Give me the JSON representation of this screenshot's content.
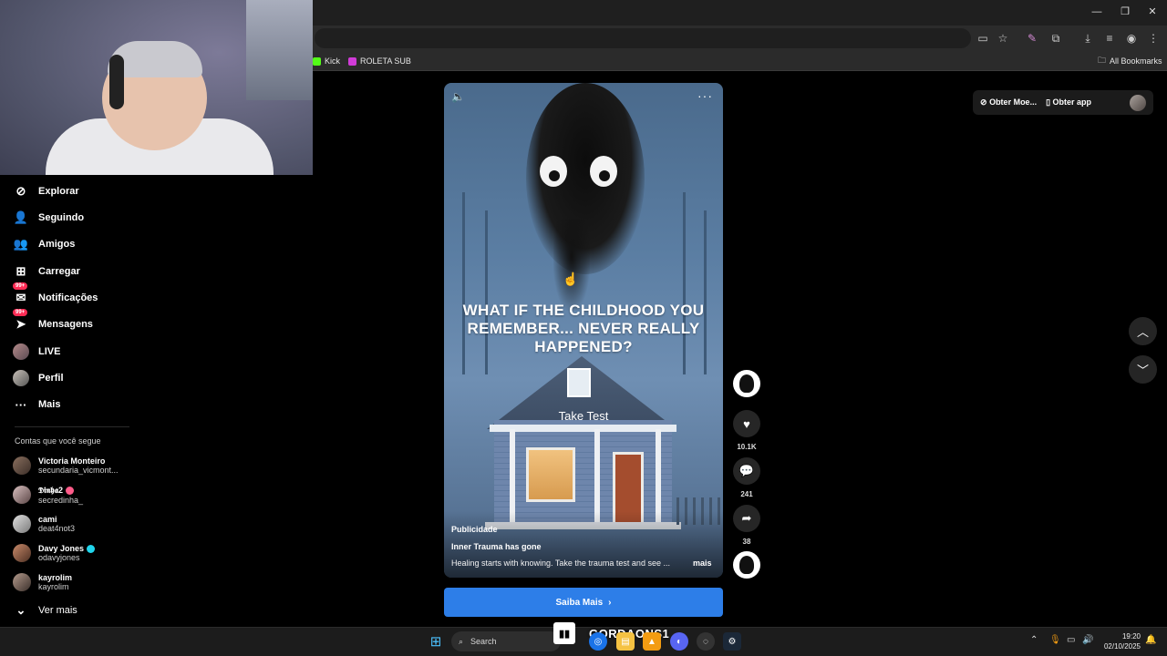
{
  "browser": {
    "window_controls": {
      "minimize": "—",
      "maximize": "❐",
      "close": "✕"
    },
    "bookmarks": [
      {
        "label": "Kick",
        "color": "#53fc18"
      },
      {
        "label": "ROLETA SUB",
        "color": "#d13bd8"
      }
    ],
    "all_bookmarks": "All Bookmarks"
  },
  "sidebar": {
    "items": [
      {
        "label": "Explorar",
        "icon": "compass-icon"
      },
      {
        "label": "Seguindo",
        "icon": "following-icon"
      },
      {
        "label": "Amigos",
        "icon": "friends-icon"
      },
      {
        "label": "Carregar",
        "icon": "upload-icon"
      },
      {
        "label": "Notificações",
        "icon": "notifications-icon",
        "badge": "99+"
      },
      {
        "label": "Mensagens",
        "icon": "messages-icon",
        "badge": "99+"
      },
      {
        "label": "LIVE",
        "icon": "live-avatar"
      },
      {
        "label": "Perfil",
        "icon": "profile-avatar"
      },
      {
        "label": "Mais",
        "icon": "more-icon"
      }
    ],
    "section_title": "Contas que você segue",
    "accounts": [
      {
        "name": "Victoria Monteiro",
        "handle": "secundaria_vicmont..."
      },
      {
        "name": "𝕯𝖎𝖓𝖍𝖆2",
        "handle": "secredinha_",
        "emoji": "lips"
      },
      {
        "name": "cami",
        "handle": "deat4not3"
      },
      {
        "name": "Davy Jones",
        "handle": "odavyjones",
        "verified": true
      },
      {
        "name": "kayrolim",
        "handle": "kayrolim"
      }
    ],
    "see_more": "Ver mais"
  },
  "video": {
    "headline": "WHAT IF THE CHILDHOOD YOU REMEMBER... NEVER REALLY HAPPENED?",
    "take_test": "Take Test",
    "label": "Publicidade",
    "ad_title": "Inner Trauma has gone",
    "ad_desc": "Healing starts with knowing. Take the trauma test and see ...",
    "more": "mais",
    "menu": "···"
  },
  "cta": {
    "label": "Saiba Mais",
    "chevron": "›"
  },
  "actions": {
    "likes": "10.1K",
    "comments": "241",
    "shares": "38"
  },
  "topright": {
    "coins": "Obter Moe...",
    "app": "Obter app"
  },
  "taskbar": {
    "search": "Search",
    "time": "19:20",
    "date": "02/10/2025",
    "streamer": "GORDAONS1"
  },
  "colors": {
    "accent": "#fe2c55",
    "cta": "#2d7ee8",
    "verified": "#20d5ec"
  }
}
